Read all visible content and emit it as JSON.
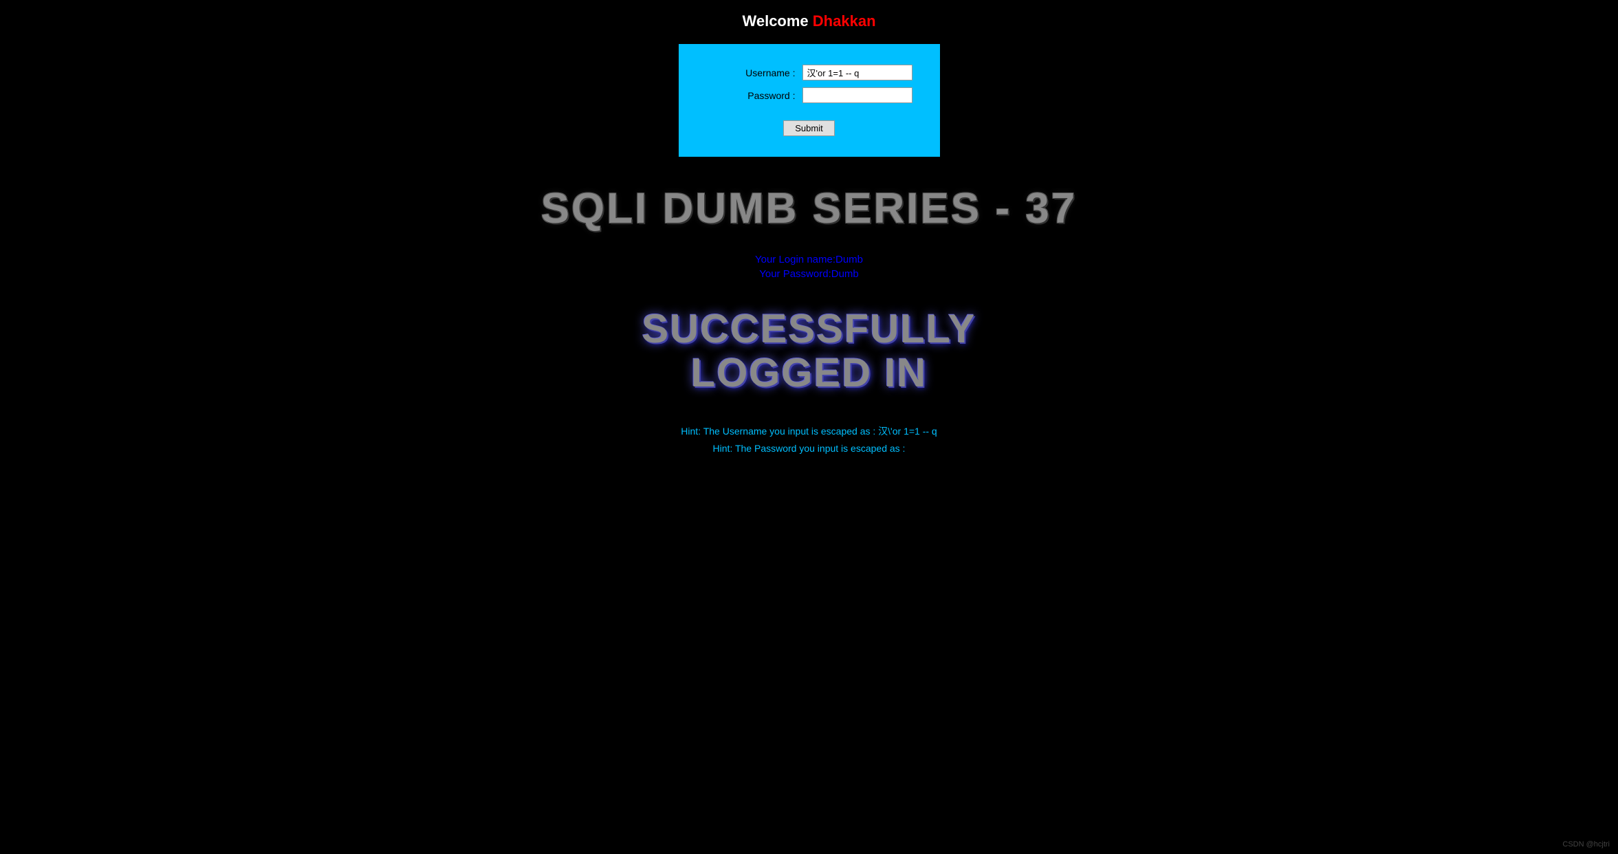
{
  "header": {
    "welcome": "Welcome",
    "site_name": "Dhakkan"
  },
  "form": {
    "username_label": "Username :",
    "password_label": "Password :",
    "username_value": "汉'or 1=1 -- q",
    "password_value": "",
    "submit_label": "Submit"
  },
  "series_title": "SQLI DUMB SERIES - 37",
  "login_info": {
    "login_name": "Your Login name:Dumb",
    "login_password": "Your Password:Dumb"
  },
  "success_message": "SUCCESSFULLY LOGGED IN",
  "hints": {
    "username_hint": "Hint: The Username you input is escaped as : 汉\\'or 1=1 -- q",
    "password_hint": "Hint: The Password you input is escaped as :"
  },
  "watermark": "CSDN @hcjtri"
}
